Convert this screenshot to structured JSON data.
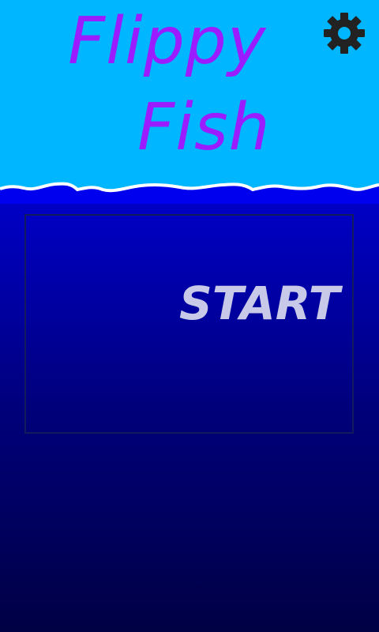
{
  "title": {
    "line1": "Flippy",
    "line2": "Fish"
  },
  "settings": {
    "icon": "gear-icon"
  },
  "start": {
    "label": "START"
  },
  "colors": {
    "sky": "#00b7ff",
    "water_top": "#0000ee",
    "water_bottom": "#000044",
    "title": "#9b1cff",
    "start_text": "#c8c8e8",
    "panel_border": "#141a5e",
    "foam": "#ffffff",
    "gear": "#222222"
  }
}
